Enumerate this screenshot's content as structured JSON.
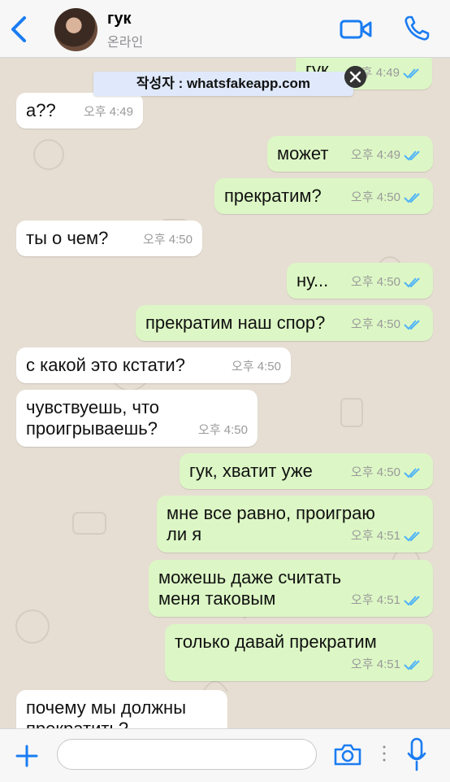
{
  "header": {
    "contact_name": "гук",
    "status": "온라인",
    "icons": [
      "back-chevron-icon",
      "video-call-icon",
      "phone-call-icon"
    ]
  },
  "watermark": {
    "text": "작성자 : whatsfakeapp.com"
  },
  "messages": [
    {
      "dir": "out",
      "text": "гук",
      "time": "오후 4:49",
      "ticks": "read"
    },
    {
      "dir": "in",
      "text": "а??",
      "time": "오후 4:49"
    },
    {
      "dir": "out",
      "text": "может",
      "time": "오후 4:49",
      "ticks": "read"
    },
    {
      "dir": "out",
      "text": "прекратим?",
      "time": "오후 4:50",
      "ticks": "read"
    },
    {
      "dir": "in",
      "text": "ты о чем?",
      "time": "오후 4:50"
    },
    {
      "dir": "out",
      "text": "ну...",
      "time": "오후 4:50",
      "ticks": "read"
    },
    {
      "dir": "out",
      "text": "прекратим наш спор?",
      "time": "오후 4:50",
      "ticks": "read"
    },
    {
      "dir": "in",
      "text": "с какой это кстати?",
      "time": "오후 4:50"
    },
    {
      "dir": "in",
      "text_lines": [
        "чувствуешь, что",
        "проигрываешь?"
      ],
      "time": "오후 4:50"
    },
    {
      "dir": "out",
      "text": "гук, хватит уже",
      "time": "오후 4:50",
      "ticks": "read"
    },
    {
      "dir": "out",
      "text_lines": [
        "мне все равно, проиграю",
        "ли я"
      ],
      "time": "오후 4:51",
      "ticks": "read"
    },
    {
      "dir": "out",
      "text_lines": [
        "можешь даже считать",
        "меня таковым"
      ],
      "time": "오후 4:51",
      "ticks": "read"
    },
    {
      "dir": "out",
      "text": "только давай прекратим",
      "time": "오후 4:51",
      "ticks": "read"
    },
    {
      "dir": "in",
      "text_lines": [
        "почему мы должны",
        "прекратить?"
      ]
    }
  ],
  "colors": {
    "accent": "#1a7cf2",
    "outgoing_bubble": "#dcf7c5",
    "incoming_bubble": "#ffffff",
    "read_ticks": "#4fb3f6"
  },
  "footer": {
    "input_placeholder": "",
    "icons": [
      "plus-icon",
      "camera-icon",
      "microphone-icon"
    ]
  }
}
